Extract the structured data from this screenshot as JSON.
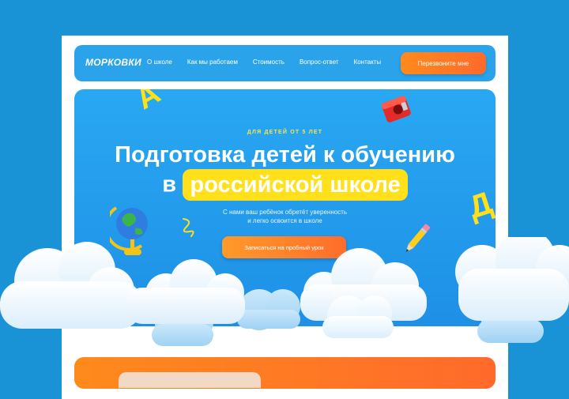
{
  "nav": {
    "logo": "МОРКОВКИ",
    "items": [
      "О школе",
      "Как мы работаем",
      "Стоимость",
      "Вопрос-ответ",
      "Контакты"
    ],
    "cta": "Перезвоните мне"
  },
  "hero": {
    "eyebrow": "ДЛЯ ДЕТЕЙ ОТ 5 ЛЕТ",
    "title_line1": "Подготовка детей к обучению",
    "title_line2_prefix": "в",
    "title_line2_highlight": "российской школе",
    "subtitle_line1": "С нами ваш ребёнок обретёт уверенность",
    "subtitle_line2": "и легко освоится в школе",
    "cta": "Записаться на пробный урок"
  },
  "decor": {
    "letter_left": "А",
    "letter_right": "Д"
  },
  "colors": {
    "background": "#1a93d6",
    "hero": "#29a8f2",
    "accent": "#ff7a24",
    "highlight": "#ffe01b"
  }
}
